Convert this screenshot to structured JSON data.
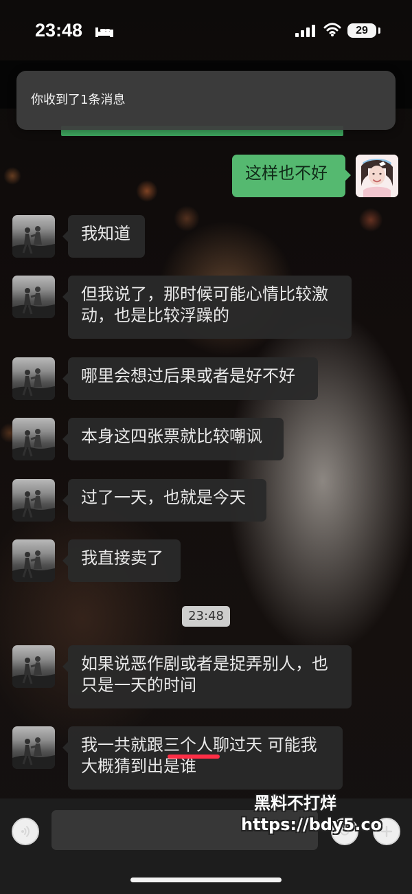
{
  "status_bar": {
    "time": "23:48",
    "battery": "29",
    "icons": [
      "bed-icon",
      "signal-icon",
      "wifi-icon",
      "battery-icon"
    ]
  },
  "notification": {
    "text": "你收到了1条消息"
  },
  "messages": [
    {
      "side": "right",
      "text": "这样也不好"
    },
    {
      "side": "left",
      "text": "我知道"
    },
    {
      "side": "left",
      "lines": [
        "但我说了，那时候可能心情比较激",
        "动，也是比较浮躁的"
      ]
    },
    {
      "side": "left",
      "text": "哪里会想过后果或者是好不好"
    },
    {
      "side": "left",
      "text": "本身这四张票就比较嘲讽"
    },
    {
      "side": "left",
      "text": "过了一天，也就是今天"
    },
    {
      "side": "left",
      "text": "我直接卖了"
    },
    {
      "side": "left",
      "lines": [
        "如果说恶作剧或者是捉弄别人，也",
        "只是一天的时间"
      ]
    },
    {
      "side": "left",
      "lines": [
        "我一共就跟三个人聊过天  可能我",
        "大概猜到出是谁"
      ]
    }
  ],
  "time_divider": "23:48",
  "input": {
    "placeholder": "",
    "value": ""
  },
  "watermark": {
    "title": "黑料不打烊",
    "url": "https://bdy5.co"
  },
  "colors": {
    "accent_green": "#55b970",
    "bubble_dark": "#2a2a2a",
    "highlight_red": "#ff2e46"
  }
}
